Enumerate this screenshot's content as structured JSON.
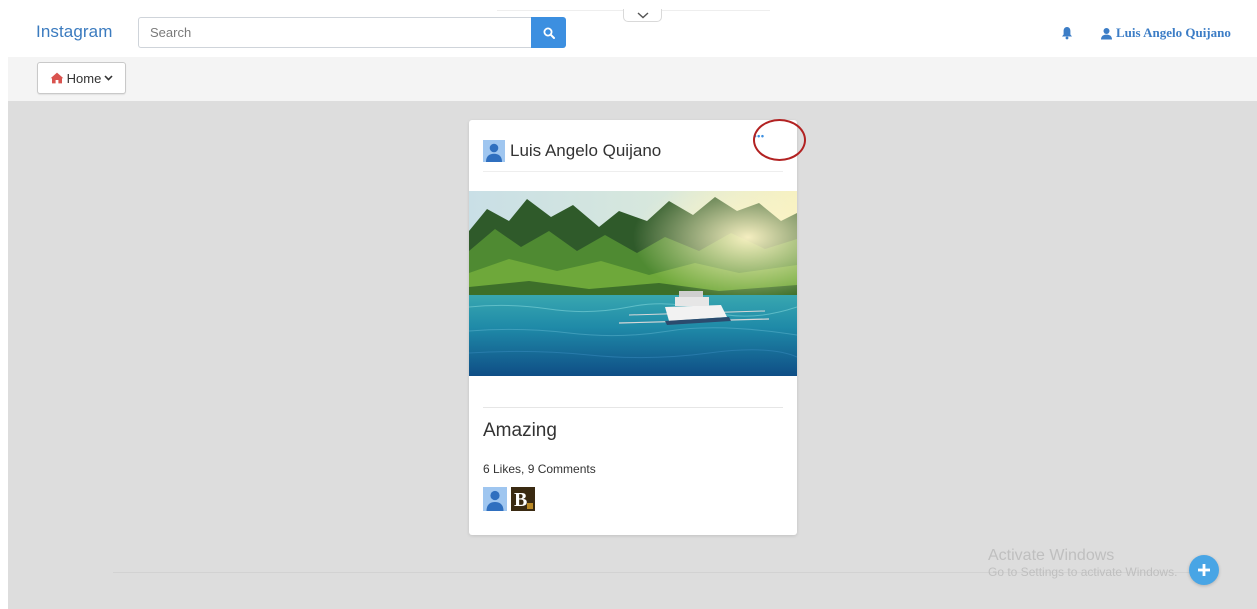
{
  "navbar": {
    "brand": "Instagram",
    "search": {
      "placeholder": "Search",
      "value": "",
      "icon": "search-icon"
    },
    "collapse_icon": "chevron-down-icon",
    "notifications_icon": "bell-icon",
    "user": {
      "name": "Luis Angelo Quijano",
      "icon": "user-icon"
    },
    "accent_color": "#3c8fe0"
  },
  "subnav": {
    "home_label": "Home",
    "home_icon": "home-icon",
    "home_icon_color": "#d9534f",
    "dropdown_icon": "chevron-down-icon"
  },
  "post": {
    "author": "Luis Angelo Quijano",
    "more_label": "•••",
    "image_subject": "lagoon-with-boat-photo",
    "caption": "Amazing",
    "stats": "6 Likes, 9 Comments",
    "likers": [
      {
        "icon": "user-avatar-icon"
      },
      {
        "icon": "b-logo-avatar",
        "letter": "B"
      }
    ]
  },
  "watermark": {
    "title": "Activate Windows",
    "subtitle": "Go to Settings to activate Windows."
  },
  "fab": {
    "icon": "plus-icon"
  }
}
